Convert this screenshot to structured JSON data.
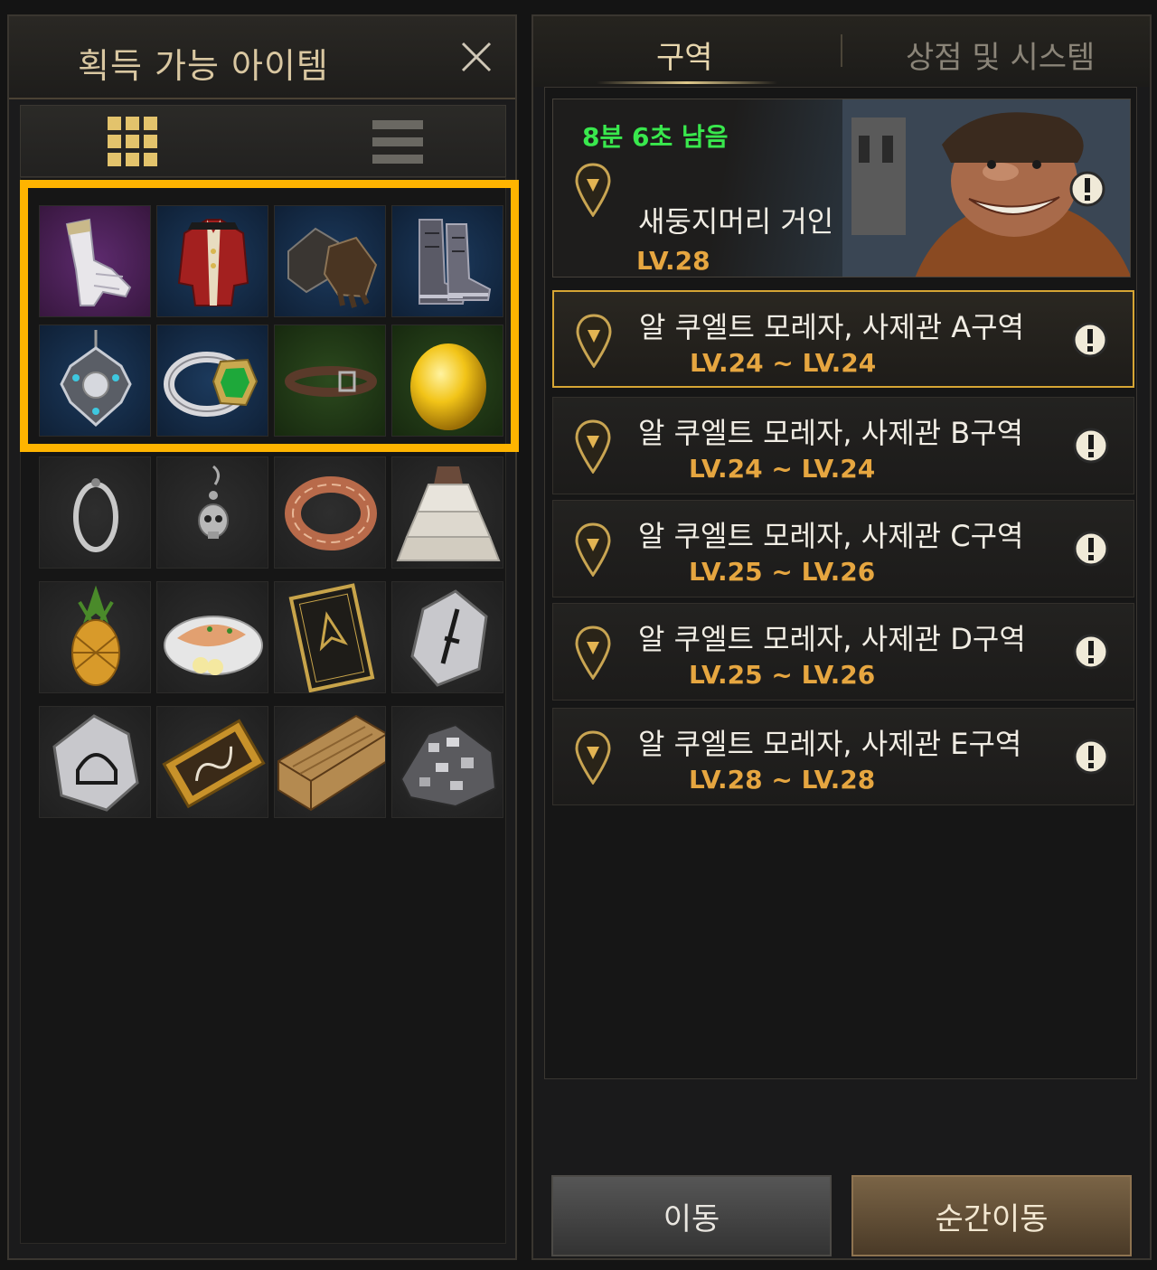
{
  "left_panel": {
    "title": "획득 가능 아이템",
    "close_icon": "close-icon",
    "view_tabs": [
      {
        "name": "grid-view",
        "icon": "grid-icon",
        "active": true
      },
      {
        "name": "list-view",
        "icon": "list-icon",
        "active": false
      }
    ],
    "items": [
      {
        "icon": "gloves-white-icon",
        "bg": "purple"
      },
      {
        "icon": "red-coat-icon",
        "bg": "blue"
      },
      {
        "icon": "leather-gauntlets-icon",
        "bg": "blue"
      },
      {
        "icon": "boots-icon",
        "bg": "blue"
      },
      {
        "icon": "necklace-icon",
        "bg": "blue"
      },
      {
        "icon": "emerald-ring-icon",
        "bg": "blue"
      },
      {
        "icon": "belt-icon",
        "bg": "green"
      },
      {
        "icon": "golden-egg-icon",
        "bg": "green"
      },
      {
        "icon": "silver-hoop-earring-icon",
        "bg": "gray"
      },
      {
        "icon": "skull-earring-icon",
        "bg": "gray"
      },
      {
        "icon": "copper-ring-icon",
        "bg": "gray"
      },
      {
        "icon": "ruffled-skirt-icon",
        "bg": "gray"
      },
      {
        "icon": "pineapple-icon",
        "bg": "gray"
      },
      {
        "icon": "fish-plate-icon",
        "bg": "gray"
      },
      {
        "icon": "card-icon",
        "bg": "gray"
      },
      {
        "icon": "sword-rune-stone-icon",
        "bg": "gray"
      },
      {
        "icon": "helmet-rune-stone-icon",
        "bg": "gray"
      },
      {
        "icon": "ticket-icon",
        "bg": "gray"
      },
      {
        "icon": "wood-planks-icon",
        "bg": "gray"
      },
      {
        "icon": "ore-pile-icon",
        "bg": "gray"
      }
    ],
    "highlight_color": "#ffb400"
  },
  "right_panel": {
    "tabs": [
      {
        "label": "구역",
        "active": true
      },
      {
        "label": "상점 및 시스템",
        "active": false
      }
    ],
    "boss": {
      "timer": "8분 6초 남음",
      "name": "새둥지머리 거인",
      "level": "LV.28"
    },
    "zones": [
      {
        "name": "알 쿠엘트 모레자, 사제관 A구역",
        "level": "LV.24 ~ LV.24",
        "selected": true
      },
      {
        "name": "알 쿠엘트 모레자, 사제관 B구역",
        "level": "LV.24 ~ LV.24",
        "selected": false
      },
      {
        "name": "알 쿠엘트 모레자, 사제관 C구역",
        "level": "LV.25 ~ LV.26",
        "selected": false
      },
      {
        "name": "알 쿠엘트 모레자, 사제관 D구역",
        "level": "LV.25 ~ LV.26",
        "selected": false
      },
      {
        "name": "알 쿠엘트 모레자, 사제관 E구역",
        "level": "LV.28 ~ LV.28",
        "selected": false
      }
    ],
    "buttons": {
      "move": "이동",
      "teleport": "순간이동"
    },
    "colors": {
      "timer": "#39e84d",
      "level": "#e6a640",
      "selected_border": "#d6a534"
    }
  }
}
